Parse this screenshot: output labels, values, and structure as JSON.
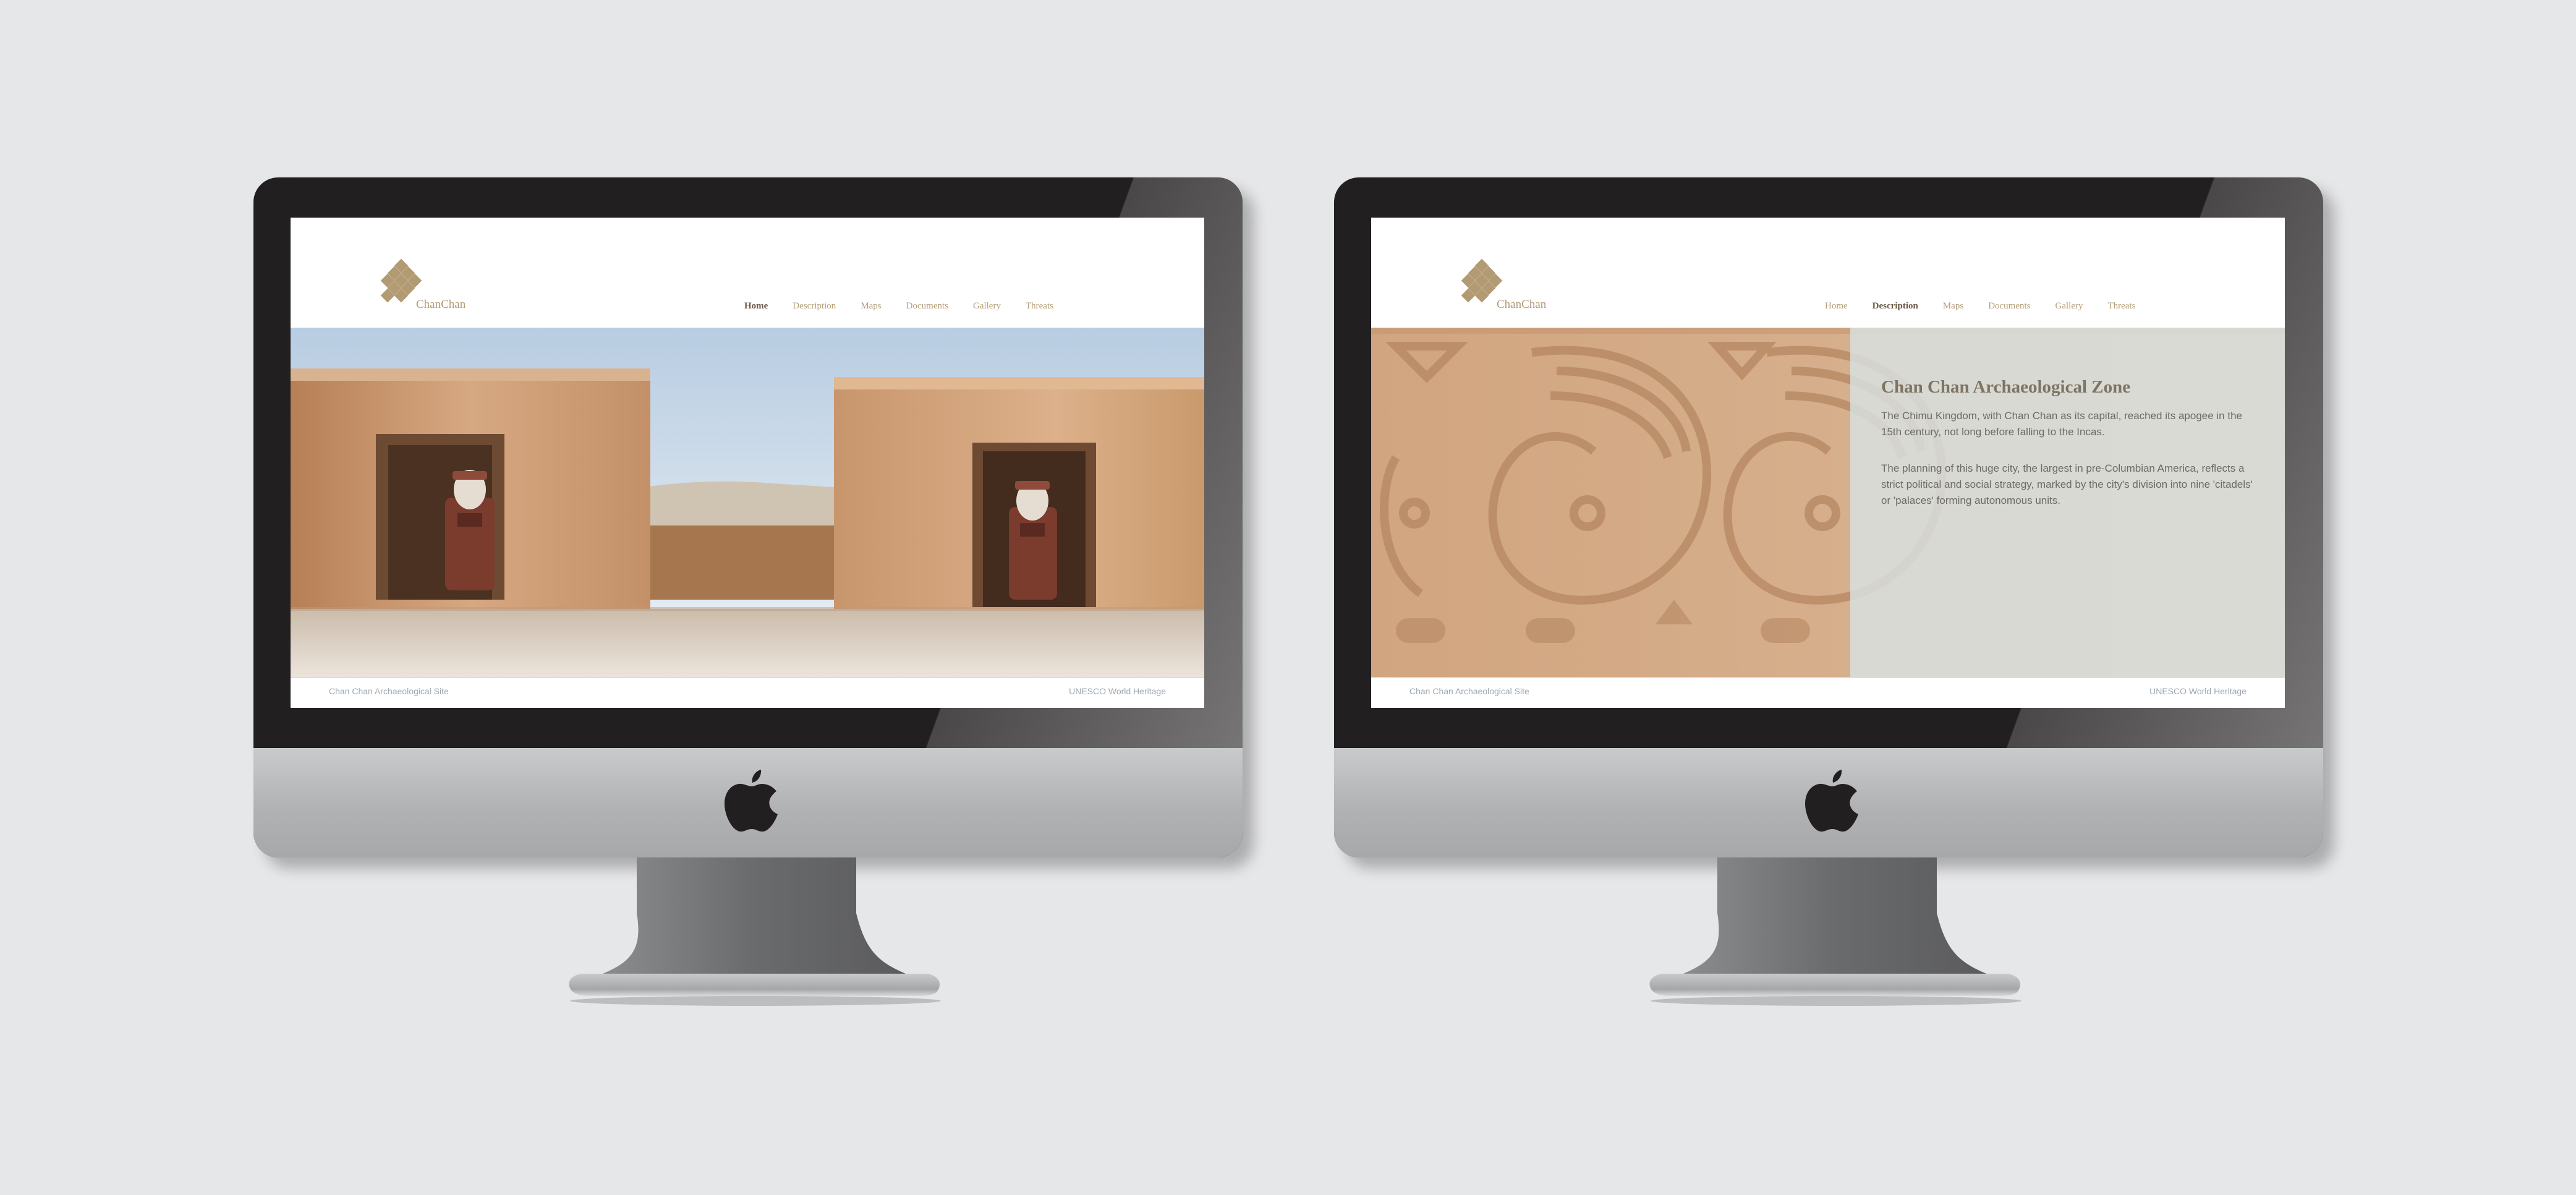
{
  "monitors": [
    {
      "site": {
        "logo_text": "ChanChan",
        "nav": [
          "Home",
          "Description",
          "Maps",
          "Documents",
          "Gallery",
          "Threats"
        ],
        "active_nav": "Home",
        "footer_left": "Chan Chan Archaeological Site",
        "footer_right": "UNESCO World Heritage"
      }
    },
    {
      "site": {
        "logo_text": "ChanChan",
        "nav": [
          "Home",
          "Description",
          "Maps",
          "Documents",
          "Gallery",
          "Threats"
        ],
        "active_nav": "Description",
        "footer_left": "Chan Chan Archaeological Site",
        "footer_right": "UNESCO World Heritage",
        "content_title": "Chan Chan Archaeological Zone",
        "content_paragraphs": [
          "The Chimu Kingdom, with Chan Chan as its capital, reached its apogee in the 15th century, not long before falling to the Incas.",
          "The planning of this huge city, the largest in pre-Columbian America, reflects a strict political and social strategy, marked by the city's division into nine 'citadels' or 'palaces' forming autonomous units."
        ]
      }
    }
  ],
  "colors": {
    "background": "#e6e7e9",
    "bezel": "#221f20",
    "brand_gold": "#b29a72",
    "nav_active": "#6a5a47",
    "footer_text": "#9ea8b2",
    "adobe": "#c99a6c"
  },
  "icons": {
    "brand_logo": "chanchan-diamond-logo-icon",
    "apple_logo": "apple-logo-icon"
  }
}
